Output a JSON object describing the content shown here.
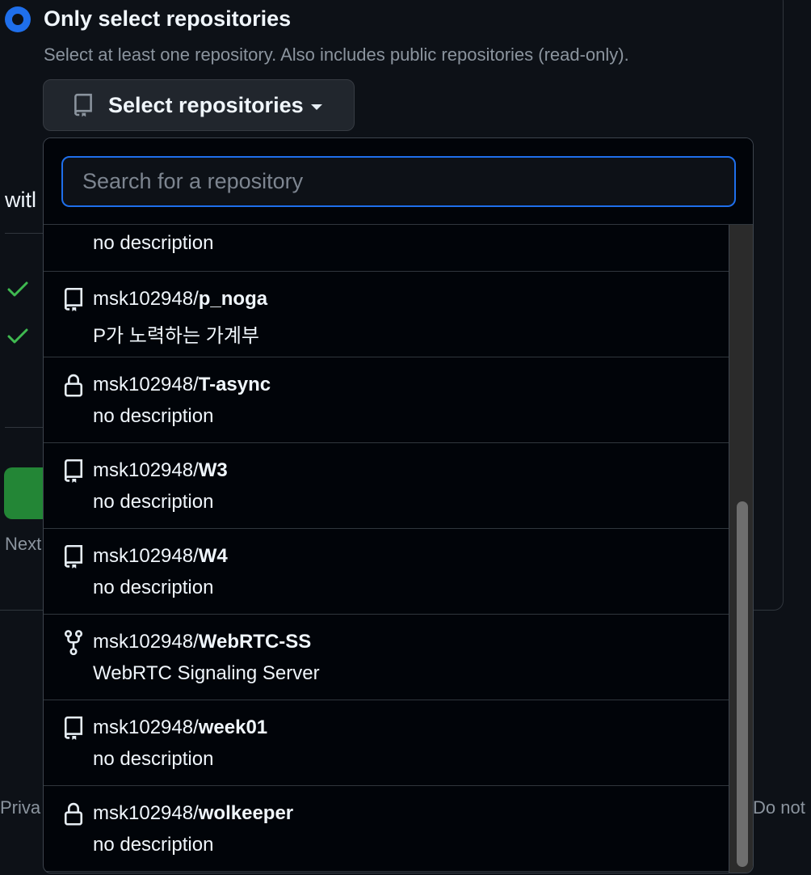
{
  "repo_access": {
    "option_title": "Only select repositories",
    "option_description": "Select at least one repository. Also includes public repositories (read-only).",
    "select_button_label": "Select repositories"
  },
  "background": {
    "heading_fragment": "witl",
    "next_fragment": "Next",
    "footer_left_fragment": "Priva",
    "footer_right_fragment": "Do not"
  },
  "dropdown": {
    "search_placeholder": "Search for a repository",
    "search_value": "",
    "partial_item": {
      "description": "no description"
    },
    "items": [
      {
        "owner": "msk102948/",
        "repo": "p_noga",
        "description": "P가 노력하는 가계부",
        "icon": "repo-icon"
      },
      {
        "owner": "msk102948/",
        "repo": "T-async",
        "description": "no description",
        "icon": "lock-icon"
      },
      {
        "owner": "msk102948/",
        "repo": "W3",
        "description": "no description",
        "icon": "repo-icon"
      },
      {
        "owner": "msk102948/",
        "repo": "W4",
        "description": "no description",
        "icon": "repo-icon"
      },
      {
        "owner": "msk102948/",
        "repo": "WebRTC-SS",
        "description": "WebRTC Signaling Server",
        "icon": "fork-icon"
      },
      {
        "owner": "msk102948/",
        "repo": "week01",
        "description": "no description",
        "icon": "repo-icon"
      },
      {
        "owner": "msk102948/",
        "repo": "wolkeeper",
        "description": "no description",
        "icon": "lock-icon"
      }
    ]
  },
  "colors": {
    "accent": "#1f6feb",
    "success": "#238636",
    "check": "#3fb950"
  }
}
